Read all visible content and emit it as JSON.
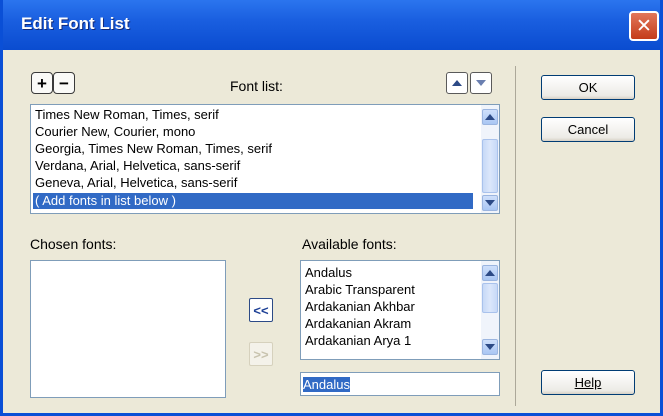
{
  "window": {
    "title": "Edit Font List",
    "close_glyph": "✕"
  },
  "toolbar": {
    "add_glyph": "+",
    "remove_glyph": "−"
  },
  "font_list": {
    "label": "Font list:",
    "items": [
      "Times New Roman, Times, serif",
      "Courier New, Courier, mono",
      "Georgia, Times New Roman, Times, serif",
      "Verdana, Arial, Helvetica, sans-serif",
      "Geneva, Arial, Helvetica, sans-serif",
      "( Add fonts in list below )"
    ],
    "selected_index": 5
  },
  "chosen": {
    "label": "Chosen fonts:",
    "items": []
  },
  "available": {
    "label": "Available fonts:",
    "items": [
      "Andalus",
      "Arabic Transparent",
      "Ardakanian Akhbar",
      "Ardakanian Akram",
      "Ardakanian Arya 1"
    ],
    "input_value": "Andalus"
  },
  "move_buttons": {
    "add_label": "<<",
    "remove_label": ">>"
  },
  "buttons": {
    "ok": "OK",
    "cancel": "Cancel",
    "help": "Help"
  },
  "colors": {
    "title_bar": "#1a5fe0",
    "selection": "#316ac5",
    "dialog_bg": "#ece9d8"
  }
}
